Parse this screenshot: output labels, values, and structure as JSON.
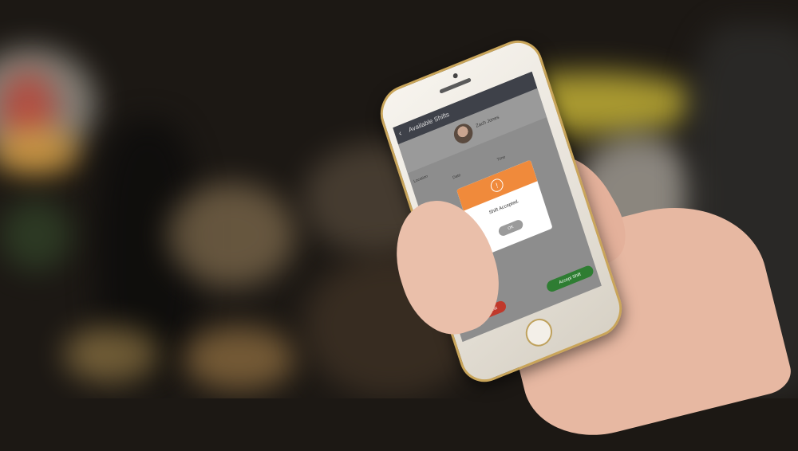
{
  "app": {
    "header_title": "Available Shifts",
    "back_icon": "chevron-left-icon",
    "user_name": "Zach Jones",
    "field_label": "Location",
    "col_labels": [
      "Date",
      "Time"
    ]
  },
  "dialog": {
    "icon": "alert-icon",
    "icon_glyph": "!",
    "message": "Shift Accepted.",
    "ok_label": "OK",
    "accent_color": "#f08a3b"
  },
  "actions": {
    "cancel_label": "Cancel Request",
    "accept_label": "Accept Shift",
    "cancel_color": "#c0392b",
    "accept_color": "#2e7d32"
  }
}
